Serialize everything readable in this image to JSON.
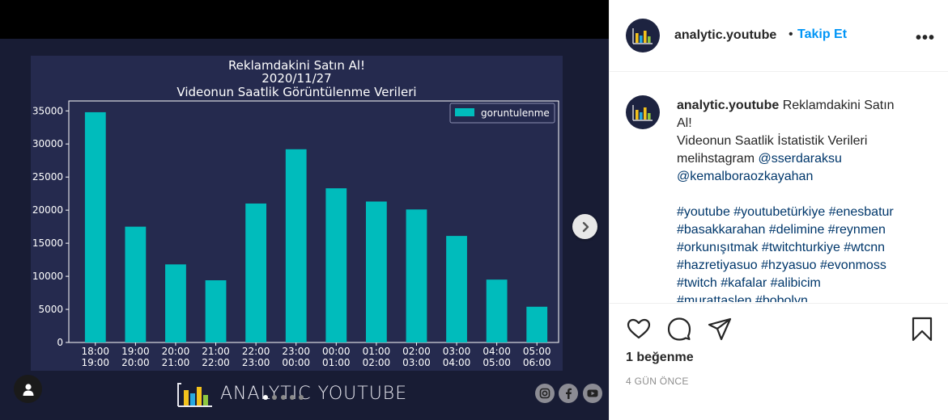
{
  "post": {
    "chart_data": {
      "type": "bar",
      "title": [
        "Reklamdakini Satın Al!",
        "2020/11/27",
        "Videonun Saatlik Görüntülenme Verileri"
      ],
      "categories": [
        [
          "18:00",
          "19:00"
        ],
        [
          "19:00",
          "20:00"
        ],
        [
          "20:00",
          "21:00"
        ],
        [
          "21:00",
          "22:00"
        ],
        [
          "22:00",
          "23:00"
        ],
        [
          "23:00",
          "00:00"
        ],
        [
          "00:00",
          "01:00"
        ],
        [
          "01:00",
          "02:00"
        ],
        [
          "02:00",
          "03:00"
        ],
        [
          "03:00",
          "04:00"
        ],
        [
          "04:00",
          "05:00"
        ],
        [
          "05:00",
          "06:00"
        ]
      ],
      "series": [
        {
          "name": "goruntulenme",
          "values": [
            34800,
            17500,
            11800,
            9400,
            21000,
            29200,
            23300,
            21300,
            20100,
            16100,
            9500,
            5400
          ]
        }
      ],
      "yticks": [
        "0",
        "5000",
        "10000",
        "15000",
        "20000",
        "25000",
        "30000",
        "35000"
      ],
      "ylim": [
        0,
        36500
      ],
      "grid": false,
      "legend_position": "top-right",
      "colors": {
        "bar": "#00bcbc",
        "background": "#252a4e",
        "text": "#ffffff"
      }
    },
    "brand_text": "ANALYTIC YOUTUBE",
    "carousel_dots": 5,
    "social_icons": [
      "instagram-icon",
      "facebook-icon",
      "youtube-icon"
    ]
  },
  "header": {
    "username": "analytic.youtube",
    "separator": "•",
    "follow_label": "Takip Et",
    "more_label": "•••"
  },
  "caption": {
    "username": "analytic.youtube",
    "text_line1": "Reklamdakini Satın",
    "text_line2": "Al!",
    "text_line3": "Videonun Saatlik İstatistik Verileri",
    "text_line4_prefix": "melihstagram",
    "mention1": "@sserdaraksu",
    "mention2": "@kemalboraozkayahan",
    "hashtag_lines": [
      "#youtube #youtubetürkiye #enesbatur",
      "#basakkarahan #delimine #reynmen",
      "#orkunışıtmak #twitchturkiye #wtcnn",
      "#hazretiyasuo #hzyasuo #evonmoss",
      "#twitch #kafalar #alibicim",
      "#murattaslen #bobolyn"
    ]
  },
  "actions": {
    "likes": "1 beğenme",
    "time_ago": "4 GÜN ÖNCE"
  },
  "colors": {
    "link": "#00376b",
    "follow": "#0095f6",
    "accent": "#00bcbc"
  }
}
